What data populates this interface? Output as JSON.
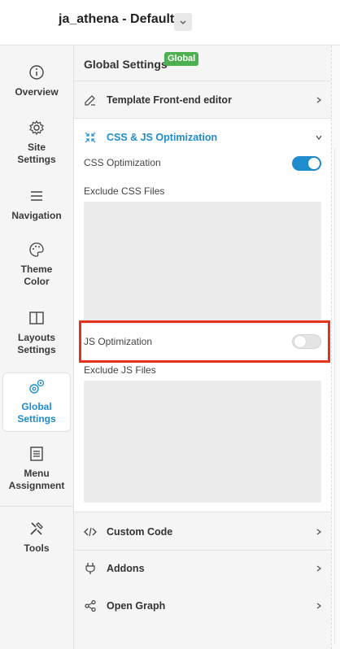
{
  "header": {
    "site_title": "ja_athena - Default"
  },
  "sidebar": {
    "items": [
      {
        "label": "Overview"
      },
      {
        "label": "Site Settings"
      },
      {
        "label": "Navigation"
      },
      {
        "label": "Theme Color"
      },
      {
        "label": "Layouts Settings"
      },
      {
        "label": "Global Settings"
      },
      {
        "label": "Menu Assignment"
      },
      {
        "label": "Tools"
      }
    ]
  },
  "panel": {
    "title": "Global Settings",
    "badge": "Global",
    "sections": {
      "template_editor": "Template Front-end editor",
      "css_js": "CSS & JS Optimization",
      "custom_code": "Custom Code",
      "addons": "Addons",
      "open_graph": "Open Graph"
    },
    "fields": {
      "css_optimization": {
        "label": "CSS Optimization",
        "enabled": true
      },
      "exclude_css": {
        "label": "Exclude CSS Files",
        "value": ""
      },
      "js_optimization": {
        "label": "JS Optimization",
        "enabled": false
      },
      "exclude_js": {
        "label": "Exclude JS Files",
        "value": ""
      }
    }
  },
  "colors": {
    "accent": "#1f8ccd",
    "badge": "#4caf50",
    "highlight": "#e8311a"
  }
}
